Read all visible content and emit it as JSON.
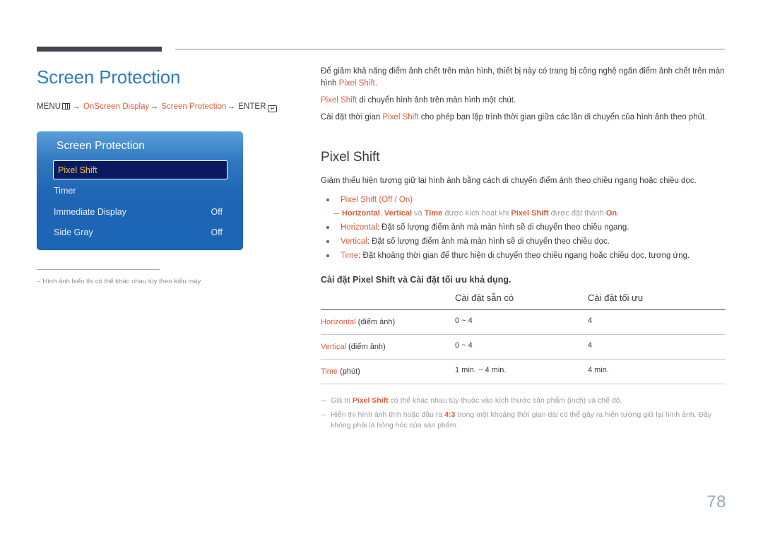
{
  "header": {
    "rule_dark_color": "#44434f",
    "rule_light_color": "#8b8b93"
  },
  "page_title": "Screen Protection",
  "breadcrumb": {
    "menu_label": "MENU",
    "menu_icon": "menu-bars-icon",
    "arrow": "→",
    "path_1": "OnScreen Display",
    "path_2": "Screen Protection",
    "enter_label": "ENTER",
    "enter_icon": "enter-key-icon",
    "enter_glyph": "↵",
    "accent_color": "#e05a3c"
  },
  "osd": {
    "title": "Screen Protection",
    "rows": [
      {
        "label": "Pixel Shift",
        "value": "",
        "selected": true
      },
      {
        "label": "Timer",
        "value": "",
        "selected": false
      },
      {
        "label": "Immediate Display",
        "value": "Off",
        "selected": false
      },
      {
        "label": "Side Gray",
        "value": "Off",
        "selected": false
      }
    ],
    "highlight_bg": "#0b1a5e",
    "highlight_text_color": "#f5c542"
  },
  "left_note": "Hình ảnh hiển thị có thể khác nhau tùy theo kiểu máy.",
  "intro": {
    "p1_a": "Để giảm khả năng điểm ảnh chết trên màn hình, thiết bị này có trang bị công nghệ ngăn điểm ảnh chết trên màn hình ",
    "p1_accent": "Pixel Shift",
    "p1_b": ".",
    "p2_accent": "Pixel Shift",
    "p2_b": " di chuyển hình ảnh trên màn hình một chút.",
    "p3_a": "Cài đặt thời gian ",
    "p3_accent": "Pixel Shift",
    "p3_b": " cho phép bạn lập trình thời gian giữa các lần di chuyển của hình ảnh theo phút."
  },
  "section": {
    "title": "Pixel Shift",
    "description": "Giảm thiểu hiện tượng giữ lại hình ảnh bằng cách di chuyển điểm ảnh theo chiều ngang hoặc chiều dọc."
  },
  "bullets": {
    "b1_accent": "Pixel Shift",
    "b1_rest": " (Off / On)",
    "sub_a1": "Horizontal",
    "sub_comma": ", ",
    "sub_a2": "Vertical",
    "sub_mid": " và ",
    "sub_a3": "Time",
    "sub_text": " được kích hoạt khi ",
    "sub_a4": "Pixel Shift",
    "sub_text2": " được đặt thành ",
    "sub_a5": "On",
    "sub_end": ".",
    "b2_accent": "Horizontal",
    "b2_rest": ": Đặt số lượng điểm ảnh mà màn hình sẽ di chuyển theo chiều ngang.",
    "b3_accent": "Vertical",
    "b3_rest": ": Đặt số lượng điểm ảnh mà màn hình sẽ di chuyển theo chiều dọc.",
    "b4_accent": "Time",
    "b4_rest": ": Đặt khoảng thời gian để thực hiện di chuyển theo chiều ngang hoặc chiều dọc, tương ứng."
  },
  "table_heading": "Cài đặt Pixel Shift và Cài đặt tối ưu khả dụng.",
  "table": {
    "columns": [
      "",
      "Cài đặt sẵn có",
      "Cài đặt tối ưu"
    ],
    "rows": [
      {
        "label_accent": "Horizontal",
        "label_rest": " (điểm ảnh)",
        "available": "0 ~ 4",
        "optimum": "4"
      },
      {
        "label_accent": "Vertical",
        "label_rest": " (điểm ảnh)",
        "available": "0 ~ 4",
        "optimum": "4"
      },
      {
        "label_accent": "Time",
        "label_rest": " (phút)",
        "available": "1 min. ~ 4 min.",
        "optimum": "4 min."
      }
    ]
  },
  "footnotes": {
    "f1_a": "Giá trị ",
    "f1_accent": "Pixel Shift",
    "f1_b": " có thể khác nhau tùy thuộc vào kích thước sản phẩm (inch) và chế độ.",
    "f2_a": "Hiển thị hình ảnh tĩnh hoặc đầu ra ",
    "f2_accent": "4:3",
    "f2_b": " trong một khoảng thời gian dài có thể gây ra hiện tượng giữ lại hình ảnh. Đây không phải là hỏng hóc của sản phẩm."
  },
  "page_number": "78"
}
